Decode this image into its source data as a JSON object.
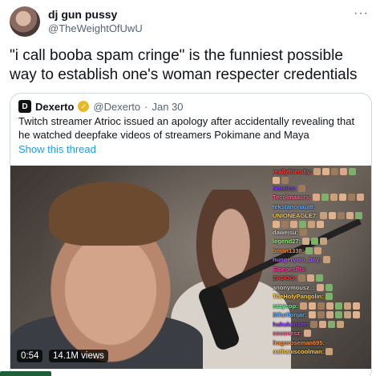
{
  "author": {
    "display_name": "dj gun pussy",
    "handle": "@TheWeightOfUwU",
    "more_icon": "more-horizontal-icon"
  },
  "tweet": {
    "text": "\"i call booba spam cringe\" is the funniest possible way to establish one's woman respecter credentials"
  },
  "quote": {
    "logo_letter": "D",
    "name": "Dexerto",
    "verified_icon": "verified-badge-icon",
    "handle": "@Dexerto",
    "separator": "·",
    "date": "Jan 30",
    "text": "Twitch streamer Atrioc issued an apology after accidentally revealing that he watched deepfake videos of streamers Pokimane and Maya",
    "show_thread": "Show this thread"
  },
  "video": {
    "duration": "0:54",
    "views": "14.1M views"
  },
  "chat": [
    {
      "user": "reallyfriendly:",
      "color": "#ff4d4d",
      "emotes": 5
    },
    {
      "user": "",
      "color": "#c8a07a",
      "emotes": 2
    },
    {
      "user": "Nomics:",
      "color": "#9147ff",
      "emotes": 1
    },
    {
      "user": "Tecolmaasrs:",
      "color": "#ff6b9a",
      "emotes": 6
    },
    {
      "user": "tekstanonaut8:",
      "color": "#6db3ff",
      "emotes": 0
    },
    {
      "user": "UNIONEAGLE7:",
      "color": "#ffd24d",
      "emotes": 5
    },
    {
      "user": "",
      "color": "#c8a07a",
      "emotes": 6
    },
    {
      "user": "daweisu:",
      "color": "#cfcfcf",
      "emotes": 1
    },
    {
      "user": "legend27:",
      "color": "#8cff6b",
      "emotes": 3
    },
    {
      "user": "bman1338:",
      "color": "#ff8f3d",
      "emotes": 2
    },
    {
      "user": "hungeryolo_boy:",
      "color": "#b36bff",
      "emotes": 1
    },
    {
      "user": "ElpepesPls:",
      "color": "#ff4da6",
      "emotes": 0
    },
    {
      "user": "ZADOG:",
      "color": "#ff3d3d",
      "emotes": 3
    },
    {
      "user": "anonymousz_:",
      "color": "#cfcfcf",
      "emotes": 2
    },
    {
      "user": "TheHolyPangolin:",
      "color": "#ffd24d",
      "emotes": 1
    },
    {
      "user": "ezzycop:",
      "color": "#6dff9e",
      "emotes": 7
    },
    {
      "user": "Bifurlionjar:",
      "color": "#6db3ff",
      "emotes": 6
    },
    {
      "user": "hukukanser:",
      "color": "#9147ff",
      "emotes": 4
    },
    {
      "user": "coconesz:",
      "color": "#ff6b9a",
      "emotes": 1
    },
    {
      "user": "fragoroseman695:",
      "color": "#ff8f3d",
      "emotes": 0
    },
    {
      "user": "nathaniscoolman:",
      "color": "#ffd24d",
      "emotes": 1
    }
  ],
  "colors": {
    "link": "#1d9bf0",
    "secondary_text": "#536471",
    "border": "#cfd9de",
    "verified": "#e8b923"
  }
}
